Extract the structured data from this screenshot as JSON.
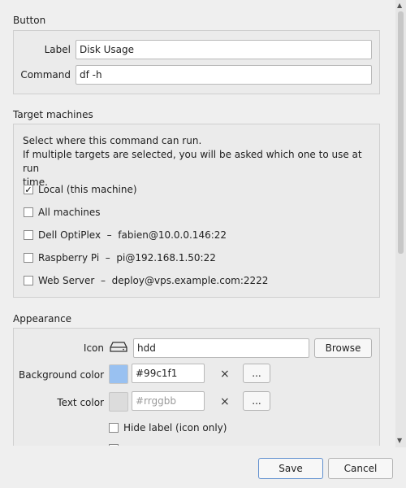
{
  "button_section": {
    "title": "Button",
    "label_label": "Label",
    "label_value": "Disk Usage",
    "command_label": "Command",
    "command_value": "df -h"
  },
  "targets_section": {
    "title": "Target machines",
    "desc_line1": "Select where this command can run.",
    "desc_line2": "If multiple targets are selected, you will be asked which one to use at run",
    "desc_line3": "time.",
    "items": [
      {
        "label": "Local (this machine)",
        "checked": true
      },
      {
        "label": "All machines",
        "checked": false
      },
      {
        "label": "Dell OptiPlex  –  fabien@10.0.0.146:22",
        "checked": false
      },
      {
        "label": "Raspberry Pi  –  pi@192.168.1.50:22",
        "checked": false
      },
      {
        "label": "Web Server  –  deploy@vps.example.com:2222",
        "checked": false
      }
    ]
  },
  "appearance_section": {
    "title": "Appearance",
    "icon_label": "Icon",
    "icon_name": "hdd-icon",
    "icon_value": "hdd",
    "browse_label": "Browse",
    "bg_color_label": "Background color",
    "bg_color_value": "#99c1f1",
    "bg_swatch_color": "#99c1f1",
    "text_color_label": "Text color",
    "text_color_placeholder": "#rrggbb",
    "text_swatch_color": "#dcdcdc",
    "clear_symbol": "×",
    "pick_symbol": "...",
    "hide_label_text": "Hide label (icon only)"
  },
  "footer": {
    "save_label": "Save",
    "cancel_label": "Cancel"
  },
  "colors": {
    "accent": "#99c1f1",
    "default_button_border": "#5f8fcf"
  }
}
